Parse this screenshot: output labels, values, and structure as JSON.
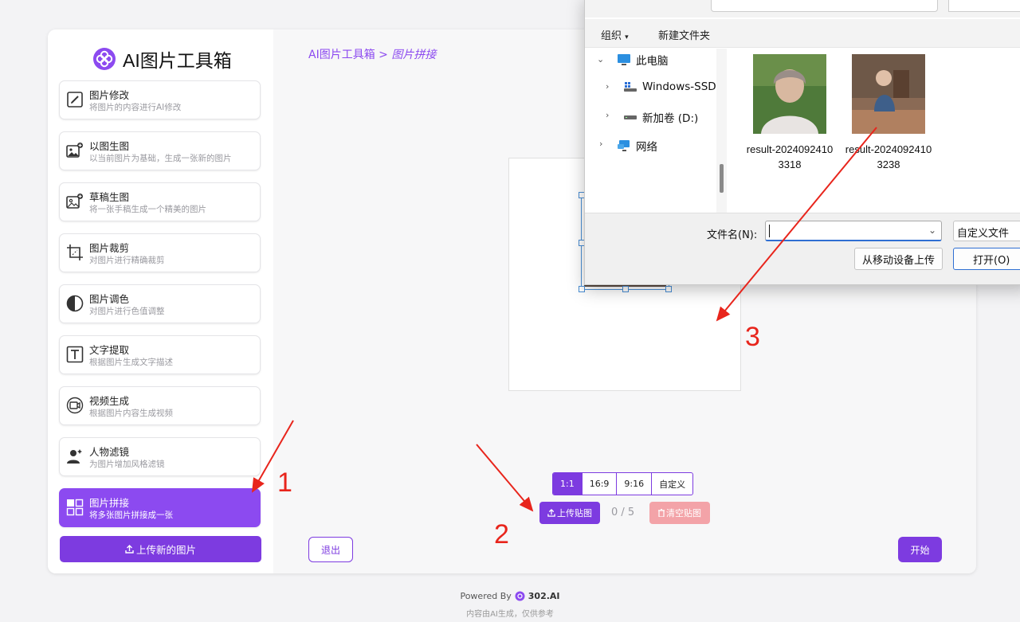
{
  "app": {
    "title": "AI图片工具箱",
    "upload_new_label": "上传新的图片"
  },
  "sidebar": {
    "items": [
      {
        "name": "图片修改",
        "desc": "将图片的内容进行AI修改",
        "icon": "edit-icon"
      },
      {
        "name": "以图生图",
        "desc": "以当前图片为基础，生成一张新的图片",
        "icon": "image-add-icon"
      },
      {
        "name": "草稿生图",
        "desc": "将一张手稿生成一个精美的图片",
        "icon": "sketch-image-icon"
      },
      {
        "name": "图片裁剪",
        "desc": "对图片进行精确裁剪",
        "icon": "crop-icon"
      },
      {
        "name": "图片调色",
        "desc": "对图片进行色值调整",
        "icon": "contrast-icon"
      },
      {
        "name": "文字提取",
        "desc": "根据图片生成文字描述",
        "icon": "text-icon"
      },
      {
        "name": "视频生成",
        "desc": "根据图片内容生成视频",
        "icon": "video-icon"
      },
      {
        "name": "人物滤镜",
        "desc": "为图片增加风格滤镜",
        "icon": "person-filter-icon"
      },
      {
        "name": "图片拼接",
        "desc": "将多张图片拼接成一张",
        "icon": "grid-icon",
        "active": true
      }
    ]
  },
  "breadcrumb": {
    "root": "AI图片工具箱",
    "separator": ">",
    "current": "图片拼接"
  },
  "ratio_options": [
    "1:1",
    "16:9",
    "9:16",
    "自定义"
  ],
  "ratio_selected": "1:1",
  "sticker": {
    "upload_label": "上传贴图",
    "count": "0 / 5",
    "clear_label": "清空贴图"
  },
  "actions": {
    "exit_label": "退出",
    "start_label": "开始"
  },
  "footer": {
    "powered_by": "Powered By",
    "brand": "302.AI",
    "note": "内容由AI生成，仅供参考"
  },
  "file_dialog": {
    "toolbar": {
      "organize": "组织",
      "new_folder": "新建文件夹"
    },
    "nav": [
      {
        "label": "此电脑",
        "icon": "computer-icon"
      },
      {
        "label": "Windows-SSD",
        "icon": "windows-drive-icon"
      },
      {
        "label": "新加卷 (D:)",
        "icon": "drive-icon"
      },
      {
        "label": "网络",
        "icon": "network-icon"
      }
    ],
    "files": [
      {
        "name": "result-20240924103318"
      },
      {
        "name": "result-20240924103238"
      }
    ],
    "filename_label": "文件名(N):",
    "filename_value": "",
    "filter_value": "自定义文件",
    "upload_mobile_label": "从移动设备上传",
    "open_label": "打开(O)"
  },
  "annotations": [
    "1",
    "2",
    "3"
  ],
  "colors": {
    "accent": "#7d3be0",
    "accent_active": "#8c4af0",
    "clear_disabled": "#f3a3a8",
    "annotation_red": "#e8251c"
  }
}
